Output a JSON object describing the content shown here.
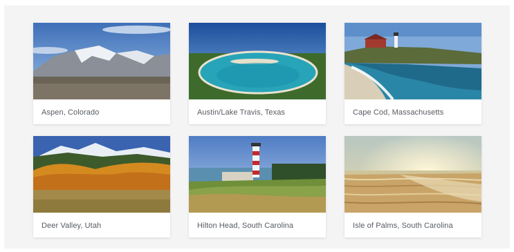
{
  "destinations": [
    {
      "label": "Aspen, Colorado",
      "image": "snowy-mountain-photo"
    },
    {
      "label": "Austin/Lake Travis, Texas",
      "image": "lake-aerial-photo"
    },
    {
      "label": "Cape Cod, Massachusetts",
      "image": "lighthouse-coast-photo"
    },
    {
      "label": "Deer Valley, Utah",
      "image": "autumn-mountain-photo"
    },
    {
      "label": "Hilton Head, South Carolina",
      "image": "lighthouse-golf-photo"
    },
    {
      "label": "Isle of Palms, South Carolina",
      "image": "beach-sunset-photo"
    }
  ]
}
